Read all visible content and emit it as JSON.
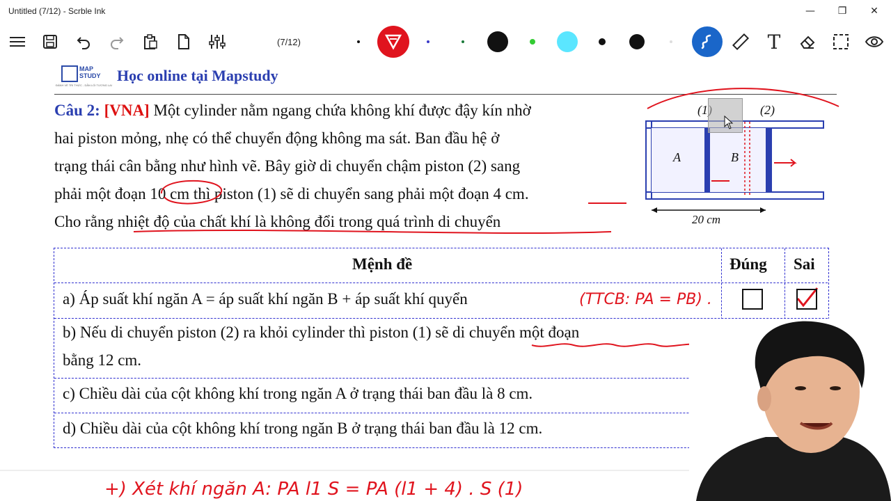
{
  "window": {
    "title": "Untitled (7/12) - Scrble Ink",
    "controls": {
      "minimize": "—",
      "restore": "❐",
      "close": "✕"
    }
  },
  "toolbar": {
    "page_indicator": "(7/12)",
    "pen_colors": [
      "#111111",
      "#e0141e",
      "#3a3ac8",
      "#1b7a3a",
      "#111111",
      "#33cc33",
      "#5be6ff",
      "#111111",
      "#111111",
      "#dddddd"
    ],
    "tools": [
      "menu-icon",
      "save-icon",
      "undo-icon",
      "redo-icon",
      "paste-icon",
      "new-page-icon",
      "settings-sliders-icon",
      "pen-icon",
      "ruler-icon",
      "text-icon",
      "eraser-icon",
      "select-icon",
      "view-icon"
    ],
    "text_tool_glyph": "T",
    "accent": "#1a66c9"
  },
  "document": {
    "logo_line1": "MAP",
    "logo_line2": "STUDY",
    "logo_sub": "ĐÁNH VỀ TRI THỨC - DẪN LỐI TƯƠNG LAI",
    "banner": "Học online tại Mapstudy",
    "question": {
      "label": "Câu 2:",
      "tag": "[VNA]",
      "line1": "Một cylinder nằm ngang chứa không khí được đậy kín nhờ",
      "line2": "hai piston mỏng, nhẹ có thể chuyển động không ma sát. Ban đầu hệ ở",
      "line3": "trạng thái cân bằng như hình vẽ. Bây giờ di chuyển chậm piston (2) sang",
      "line4": "phải một đoạn 10 cm thì piston (1) sẽ di chuyển sang phải một đoạn 4 cm.",
      "line5": "Cho rằng nhiệt độ của chất khí là không đổi trong quá trình di chuyển"
    },
    "figure": {
      "piston1": "(1)",
      "piston2": "(2)",
      "chamber_a": "A",
      "chamber_b": "B",
      "length": "20 cm"
    },
    "table": {
      "headers": [
        "Mệnh đề",
        "Đúng",
        "Sai"
      ],
      "rows": [
        {
          "text": "a) Áp suất khí ngăn A = áp suất khí ngăn B + áp suất khí quyển"
        },
        {
          "text": "b) Nếu di chuyển piston (2) ra khỏi cylinder thì piston (1) sẽ di chuyển một đoạn",
          "text2": "bằng 12 cm."
        },
        {
          "text": "c) Chiều dài của cột không khí trong ngăn A ở trạng thái ban đầu là 8 cm."
        },
        {
          "text": "d) Chiều dài của cột không khí trong ngăn B ở trạng thái ban đầu là 12 cm."
        }
      ]
    },
    "annotations": {
      "note_a": "(TTCB: PA = PB) .",
      "bottom_line": "+)   Xét khí ngăn A:   PA l1 S  =  PA (l1 + 4) . S      (1)"
    }
  }
}
